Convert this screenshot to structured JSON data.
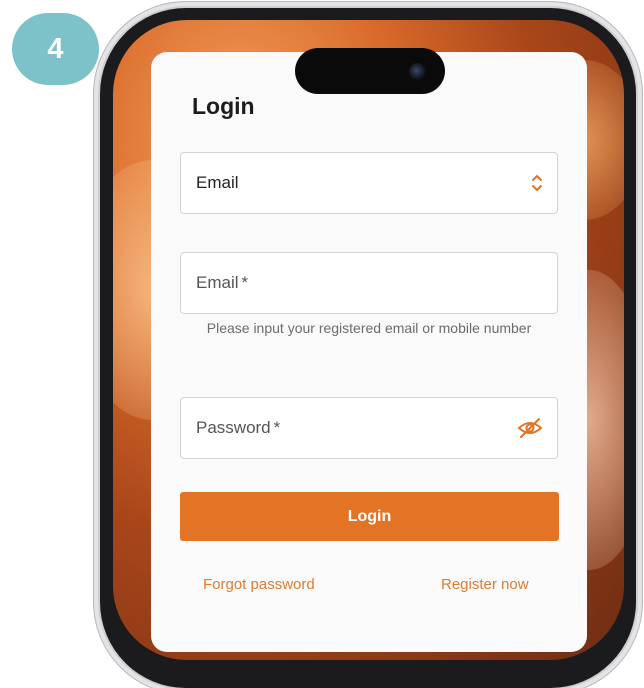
{
  "step_badge": "4",
  "login": {
    "title": "Login",
    "type_select": {
      "value": "Email",
      "icon": "chevron-up-down-icon"
    },
    "email_field": {
      "placeholder": "Email",
      "required_mark": "*"
    },
    "email_helper": "Please input your registered email or mobile number",
    "password_field": {
      "placeholder": "Password",
      "required_mark": "*",
      "icon": "eye-off-icon"
    },
    "login_button": "Login",
    "forgot_password": "Forgot password",
    "register_now": "Register now"
  },
  "colors": {
    "accent": "#e27424",
    "badge": "#7dc2c9",
    "link": "#df7a30"
  }
}
